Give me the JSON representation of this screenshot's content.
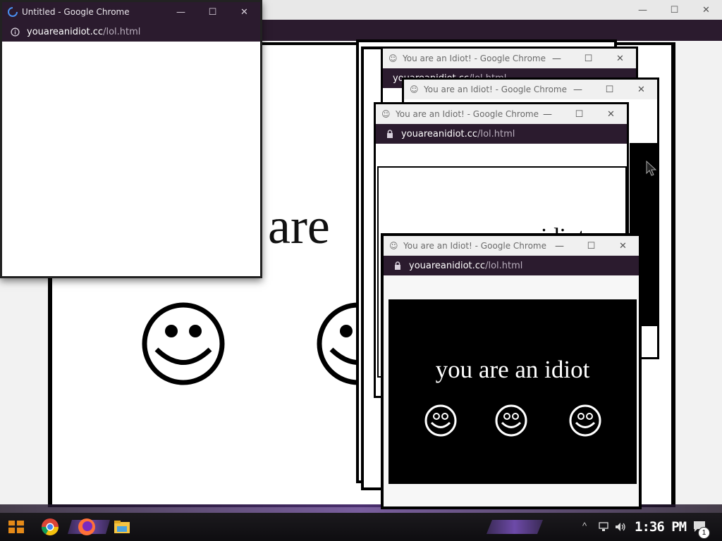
{
  "back_window": {
    "big_text": "are"
  },
  "untitled_window": {
    "title": "Untitled - Google Chrome",
    "url_domain": "youareanidiot.cc",
    "url_path": "/lol.html"
  },
  "idiot_window_title": "You are an Idiot! - Google Chrome",
  "idiot_url_domain": "youareanidiot.cc",
  "idiot_url_path": "/lol.html",
  "mid_window": {
    "partial_text": "idiot"
  },
  "front_window": {
    "message": "you are an idiot"
  },
  "taskbar": {
    "clock": "1:36 PM",
    "notification_count": "1"
  },
  "icons": {
    "minimize": "—",
    "maximize": "☐",
    "close": "✕",
    "up_arrow": "^"
  },
  "colors": {
    "accent_purple": "#2b1b2e",
    "taskbar_purple": "#6d4aa8"
  }
}
